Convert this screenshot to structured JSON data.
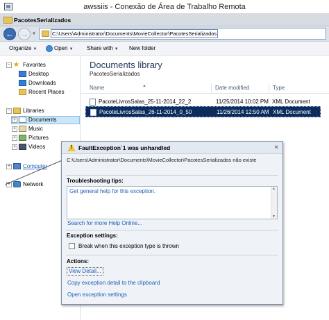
{
  "rdp": {
    "title": "awssiis - Conexão de Área de Trabalho Remota"
  },
  "window": {
    "title": "PacotesSerializados"
  },
  "address": {
    "path": "C:\\Users\\Administrator\\Documents\\MovieCollector\\PacotesSerializados"
  },
  "toolbar": {
    "organize": "Organize",
    "open": "Open",
    "share": "Share with",
    "new_folder": "New folder"
  },
  "nav": {
    "favorites": {
      "label": "Favorites",
      "items": [
        "Desktop",
        "Downloads",
        "Recent Places"
      ]
    },
    "libraries": {
      "label": "Libraries",
      "items": [
        "Documents",
        "Music",
        "Pictures",
        "Videos"
      ]
    },
    "computer": "Computer",
    "network": "Network"
  },
  "library": {
    "title": "Documents library",
    "subtitle": "PacotesSerializados"
  },
  "columns": [
    "Name",
    "Date modified",
    "Type"
  ],
  "files": [
    {
      "name": "PacoteLivrosSalas_25-11-2014_22_2",
      "date": "11/25/2014 10:02 PM",
      "type": "XML Document",
      "selected": false
    },
    {
      "name": "PacoteLivrosSalas_26-11-2014_0_50",
      "date": "11/26/2014 12:50 AM",
      "type": "XML Document",
      "selected": true
    }
  ],
  "exception": {
    "title": "FaultException`1 was unhandled",
    "message": "C:\\Users\\Administrator\\Documents\\MovieCollector\\PacotesSerializados não existe",
    "tips_title": "Troubleshooting tips:",
    "tips_item": "Get general help for this exception.",
    "search_link": "Search for more Help Online...",
    "settings_title": "Exception settings:",
    "break_label": "Break when this exception type is thrown",
    "actions_title": "Actions:",
    "view_detail": "View Detail...",
    "copy_detail": "Copy exception detail to the clipboard",
    "open_settings": "Open exception settings"
  }
}
